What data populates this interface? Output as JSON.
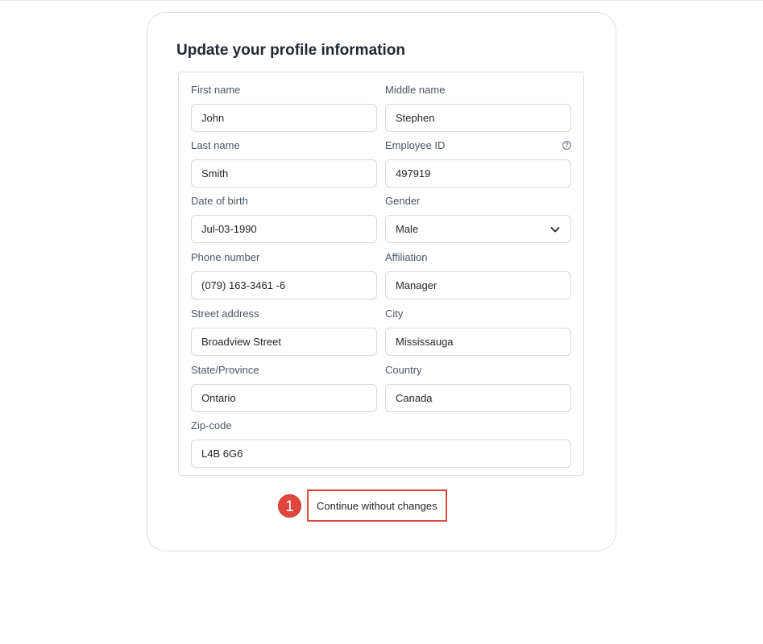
{
  "form": {
    "title": "Update your profile information",
    "fields": {
      "first_name": {
        "label": "First name",
        "value": "John"
      },
      "middle_name": {
        "label": "Middle name",
        "value": "Stephen"
      },
      "last_name": {
        "label": "Last name",
        "value": "Smith"
      },
      "employee_id": {
        "label": "Employee ID",
        "value": "497919",
        "help_icon": "question-circle-icon"
      },
      "dob": {
        "label": "Date of birth",
        "value": "Jul-03-1990"
      },
      "gender": {
        "label": "Gender",
        "value": "Male",
        "icon": "chevron-down-icon"
      },
      "phone": {
        "label": "Phone number",
        "value": "(079) 163-3461 -6"
      },
      "affiliation": {
        "label": "Affiliation",
        "value": "Manager"
      },
      "street": {
        "label": "Street address",
        "value": "Broadview Street"
      },
      "city": {
        "label": "City",
        "value": "Mississauga"
      },
      "state": {
        "label": "State/Province",
        "value": "Ontario"
      },
      "country": {
        "label": "Country",
        "value": "Canada"
      },
      "zip": {
        "label": "Zip-code",
        "value": "L4B 6G6"
      }
    },
    "continue_label": "Continue without changes",
    "step_badge": "1"
  },
  "colors": {
    "accent": "#e0463d",
    "border": "#dcdfe4"
  }
}
